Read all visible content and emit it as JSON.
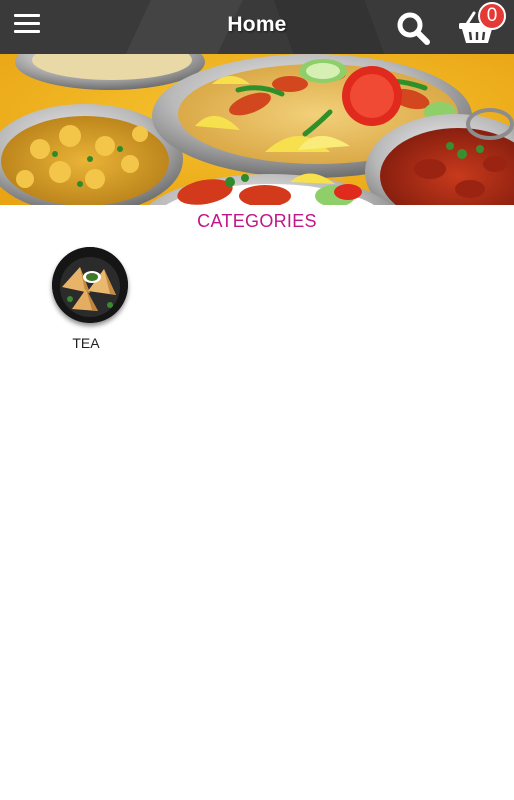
{
  "header": {
    "title": "Home",
    "menu_icon": "hamburger-menu-icon",
    "search_icon": "search-icon",
    "cart_icon": "shopping-basket-icon",
    "cart_count": "0",
    "background_color": "#3a3a3a"
  },
  "banner": {
    "image": "indian-food-platter"
  },
  "categories": {
    "heading": "CATEGORIES",
    "heading_color": "#c0168a",
    "items": [
      {
        "label": "TEA",
        "image": "samosa-plate"
      }
    ]
  }
}
